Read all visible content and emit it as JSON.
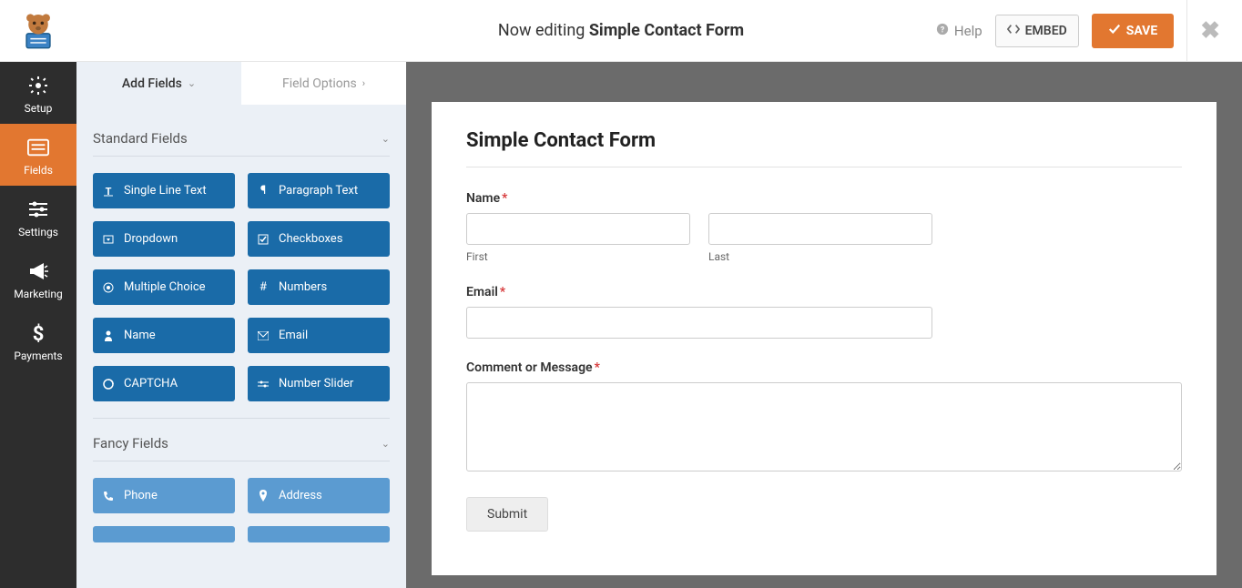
{
  "topbar": {
    "now_editing_prefix": "Now editing ",
    "form_name": "Simple Contact Form",
    "help_label": "Help",
    "embed_label": "EMBED",
    "save_label": "SAVE"
  },
  "subbar": {
    "title": "Fields"
  },
  "leftnav": {
    "items": [
      {
        "key": "setup",
        "label": "Setup"
      },
      {
        "key": "fields",
        "label": "Fields"
      },
      {
        "key": "settings",
        "label": "Settings"
      },
      {
        "key": "marketing",
        "label": "Marketing"
      },
      {
        "key": "payments",
        "label": "Payments"
      }
    ]
  },
  "panel": {
    "tabs": {
      "add": "Add Fields",
      "options": "Field Options"
    },
    "sections": {
      "standard": {
        "title": "Standard Fields",
        "fields": [
          {
            "label": "Single Line Text",
            "icon": "text"
          },
          {
            "label": "Paragraph Text",
            "icon": "paragraph"
          },
          {
            "label": "Dropdown",
            "icon": "dropdown"
          },
          {
            "label": "Checkboxes",
            "icon": "checkbox"
          },
          {
            "label": "Multiple Choice",
            "icon": "radio"
          },
          {
            "label": "Numbers",
            "icon": "hash"
          },
          {
            "label": "Name",
            "icon": "user"
          },
          {
            "label": "Email",
            "icon": "envelope"
          },
          {
            "label": "CAPTCHA",
            "icon": "captcha"
          },
          {
            "label": "Number Slider",
            "icon": "slider"
          }
        ]
      },
      "fancy": {
        "title": "Fancy Fields",
        "fields": [
          {
            "label": "Phone",
            "icon": "phone"
          },
          {
            "label": "Address",
            "icon": "pin"
          }
        ]
      }
    }
  },
  "preview": {
    "form_title": "Simple Contact Form",
    "fields": {
      "name": {
        "label": "Name",
        "required": true,
        "first_sublabel": "First",
        "last_sublabel": "Last"
      },
      "email": {
        "label": "Email",
        "required": true
      },
      "comment": {
        "label": "Comment or Message",
        "required": true
      }
    },
    "submit_label": "Submit"
  }
}
